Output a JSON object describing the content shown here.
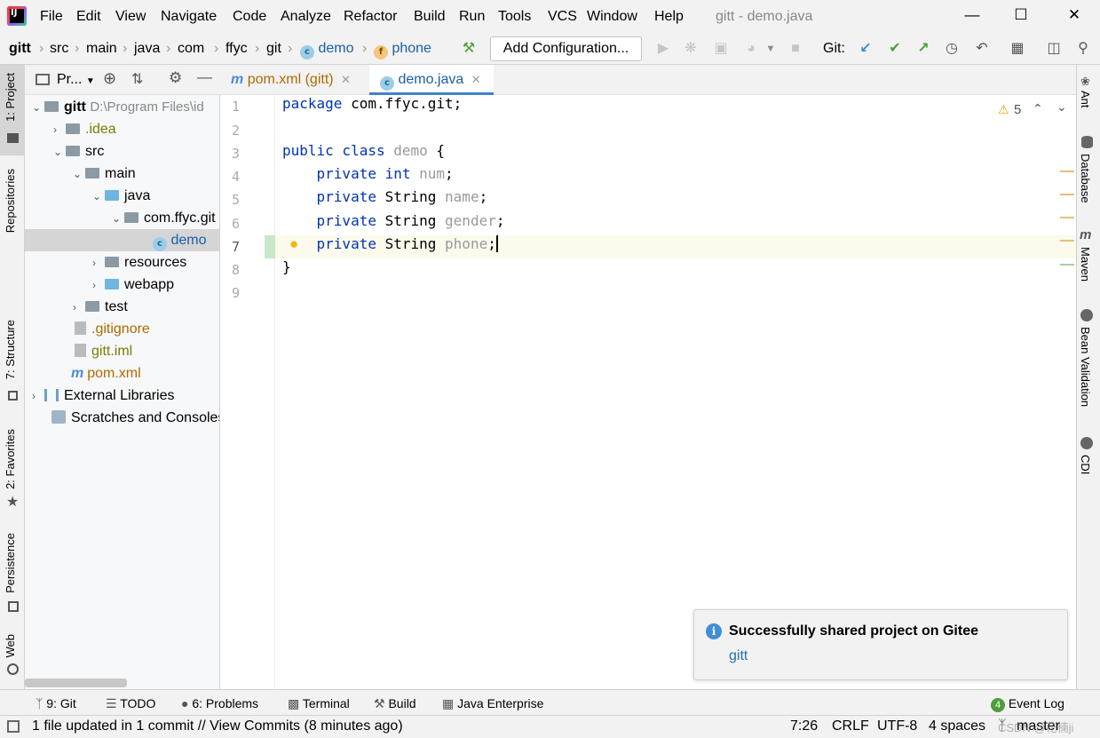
{
  "window": {
    "title": "gitt - demo.java"
  },
  "menu": [
    "File",
    "Edit",
    "View",
    "Navigate",
    "Code",
    "Analyze",
    "Refactor",
    "Build",
    "Run",
    "Tools",
    "VCS",
    "Window",
    "Help"
  ],
  "breadcrumb": [
    "gitt",
    "src",
    "main",
    "java",
    "com",
    "ffyc",
    "git",
    "demo",
    "phone"
  ],
  "toolbar": {
    "add_configuration": "Add Configuration...",
    "git_label": "Git:"
  },
  "left_tools": {
    "project": "1: Project",
    "repositories": "Repositories",
    "structure": "7: Structure",
    "favorites": "2: Favorites",
    "persistence": "Persistence",
    "web": "Web"
  },
  "project_panel": {
    "title": "Pr...",
    "tree": [
      {
        "label": "gitt",
        "extra": "D:\\Program Files\\id"
      },
      {
        "label": ".idea"
      },
      {
        "label": "src"
      },
      {
        "label": "main"
      },
      {
        "label": "java"
      },
      {
        "label": "com.ffyc.git"
      },
      {
        "label": "demo"
      },
      {
        "label": "resources"
      },
      {
        "label": "webapp"
      },
      {
        "label": "test"
      },
      {
        "label": ".gitignore"
      },
      {
        "label": "gitt.iml"
      },
      {
        "label": "pom.xml"
      },
      {
        "label": "External Libraries"
      },
      {
        "label": "Scratches and Consoles"
      }
    ]
  },
  "tabs": [
    {
      "label": "pom.xml (gitt)"
    },
    {
      "label": "demo.java"
    }
  ],
  "editor": {
    "warnings": "5",
    "line_numbers": [
      "1",
      "2",
      "3",
      "4",
      "5",
      "6",
      "7",
      "8",
      "9"
    ],
    "lines": {
      "l1a": "package",
      "l1b": " com.ffyc.git;",
      "l3a": "public class",
      "l3b": " demo",
      "l3c": " {",
      "l4a": "    private int",
      "l4b": " num",
      "l4c": ";",
      "l5a": "    private",
      "l5b": " String",
      "l5c": " name",
      "l5d": ";",
      "l6a": "    private",
      "l6b": " String",
      "l6c": " gender",
      "l6d": ";",
      "l7a": "    private",
      "l7b": " String",
      "l7c": " phone",
      "l7d": ";",
      "l8a": "}"
    }
  },
  "right_tools": {
    "ant": "Ant",
    "database": "Database",
    "maven": "Maven",
    "bean_validation": "Bean Validation",
    "cdi": "CDI"
  },
  "notification": {
    "title": "Successfully shared project on Gitee",
    "link": "gitt"
  },
  "bottom_tools": {
    "git": "9: Git",
    "todo": "TODO",
    "problems": "6: Problems",
    "terminal": "Terminal",
    "build": "Build",
    "java_enterprise": "Java Enterprise",
    "event_log": "Event Log",
    "event_count": "4"
  },
  "status": {
    "message": "1 file updated in 1 commit // View Commits (8 minutes ago)",
    "position": "7:26",
    "line_sep": "CRLF",
    "encoding": "UTF-8",
    "indent": "4 spaces",
    "branch": "master",
    "watermark": "CSDN @花楠ji"
  },
  "colors": {
    "accent": "#4083c9",
    "keyword": "#0033b3",
    "field": "#871094"
  }
}
